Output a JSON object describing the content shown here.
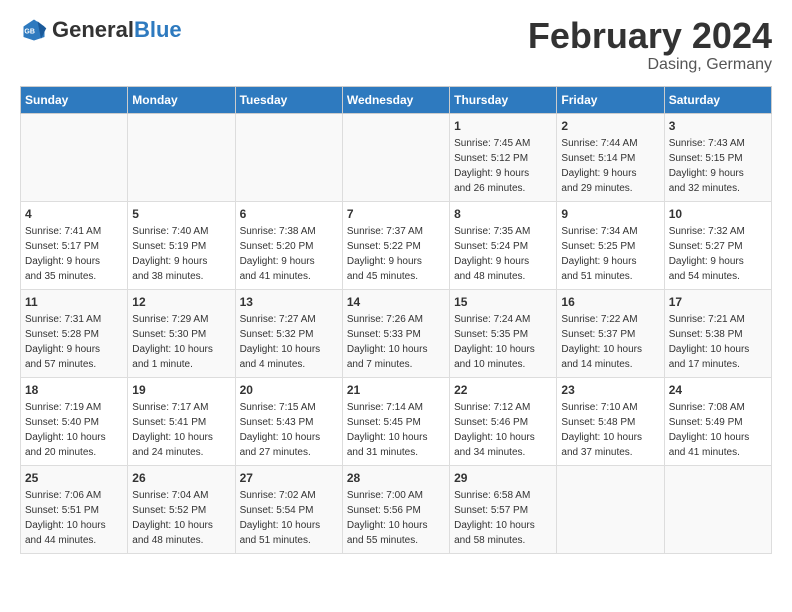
{
  "logo": {
    "text_general": "General",
    "text_blue": "Blue"
  },
  "header": {
    "month_title": "February 2024",
    "location": "Dasing, Germany"
  },
  "days_of_week": [
    "Sunday",
    "Monday",
    "Tuesday",
    "Wednesday",
    "Thursday",
    "Friday",
    "Saturday"
  ],
  "weeks": [
    [
      {
        "day": "",
        "info": ""
      },
      {
        "day": "",
        "info": ""
      },
      {
        "day": "",
        "info": ""
      },
      {
        "day": "",
        "info": ""
      },
      {
        "day": "1",
        "info": "Sunrise: 7:45 AM\nSunset: 5:12 PM\nDaylight: 9 hours\nand 26 minutes."
      },
      {
        "day": "2",
        "info": "Sunrise: 7:44 AM\nSunset: 5:14 PM\nDaylight: 9 hours\nand 29 minutes."
      },
      {
        "day": "3",
        "info": "Sunrise: 7:43 AM\nSunset: 5:15 PM\nDaylight: 9 hours\nand 32 minutes."
      }
    ],
    [
      {
        "day": "4",
        "info": "Sunrise: 7:41 AM\nSunset: 5:17 PM\nDaylight: 9 hours\nand 35 minutes."
      },
      {
        "day": "5",
        "info": "Sunrise: 7:40 AM\nSunset: 5:19 PM\nDaylight: 9 hours\nand 38 minutes."
      },
      {
        "day": "6",
        "info": "Sunrise: 7:38 AM\nSunset: 5:20 PM\nDaylight: 9 hours\nand 41 minutes."
      },
      {
        "day": "7",
        "info": "Sunrise: 7:37 AM\nSunset: 5:22 PM\nDaylight: 9 hours\nand 45 minutes."
      },
      {
        "day": "8",
        "info": "Sunrise: 7:35 AM\nSunset: 5:24 PM\nDaylight: 9 hours\nand 48 minutes."
      },
      {
        "day": "9",
        "info": "Sunrise: 7:34 AM\nSunset: 5:25 PM\nDaylight: 9 hours\nand 51 minutes."
      },
      {
        "day": "10",
        "info": "Sunrise: 7:32 AM\nSunset: 5:27 PM\nDaylight: 9 hours\nand 54 minutes."
      }
    ],
    [
      {
        "day": "11",
        "info": "Sunrise: 7:31 AM\nSunset: 5:28 PM\nDaylight: 9 hours\nand 57 minutes."
      },
      {
        "day": "12",
        "info": "Sunrise: 7:29 AM\nSunset: 5:30 PM\nDaylight: 10 hours\nand 1 minute."
      },
      {
        "day": "13",
        "info": "Sunrise: 7:27 AM\nSunset: 5:32 PM\nDaylight: 10 hours\nand 4 minutes."
      },
      {
        "day": "14",
        "info": "Sunrise: 7:26 AM\nSunset: 5:33 PM\nDaylight: 10 hours\nand 7 minutes."
      },
      {
        "day": "15",
        "info": "Sunrise: 7:24 AM\nSunset: 5:35 PM\nDaylight: 10 hours\nand 10 minutes."
      },
      {
        "day": "16",
        "info": "Sunrise: 7:22 AM\nSunset: 5:37 PM\nDaylight: 10 hours\nand 14 minutes."
      },
      {
        "day": "17",
        "info": "Sunrise: 7:21 AM\nSunset: 5:38 PM\nDaylight: 10 hours\nand 17 minutes."
      }
    ],
    [
      {
        "day": "18",
        "info": "Sunrise: 7:19 AM\nSunset: 5:40 PM\nDaylight: 10 hours\nand 20 minutes."
      },
      {
        "day": "19",
        "info": "Sunrise: 7:17 AM\nSunset: 5:41 PM\nDaylight: 10 hours\nand 24 minutes."
      },
      {
        "day": "20",
        "info": "Sunrise: 7:15 AM\nSunset: 5:43 PM\nDaylight: 10 hours\nand 27 minutes."
      },
      {
        "day": "21",
        "info": "Sunrise: 7:14 AM\nSunset: 5:45 PM\nDaylight: 10 hours\nand 31 minutes."
      },
      {
        "day": "22",
        "info": "Sunrise: 7:12 AM\nSunset: 5:46 PM\nDaylight: 10 hours\nand 34 minutes."
      },
      {
        "day": "23",
        "info": "Sunrise: 7:10 AM\nSunset: 5:48 PM\nDaylight: 10 hours\nand 37 minutes."
      },
      {
        "day": "24",
        "info": "Sunrise: 7:08 AM\nSunset: 5:49 PM\nDaylight: 10 hours\nand 41 minutes."
      }
    ],
    [
      {
        "day": "25",
        "info": "Sunrise: 7:06 AM\nSunset: 5:51 PM\nDaylight: 10 hours\nand 44 minutes."
      },
      {
        "day": "26",
        "info": "Sunrise: 7:04 AM\nSunset: 5:52 PM\nDaylight: 10 hours\nand 48 minutes."
      },
      {
        "day": "27",
        "info": "Sunrise: 7:02 AM\nSunset: 5:54 PM\nDaylight: 10 hours\nand 51 minutes."
      },
      {
        "day": "28",
        "info": "Sunrise: 7:00 AM\nSunset: 5:56 PM\nDaylight: 10 hours\nand 55 minutes."
      },
      {
        "day": "29",
        "info": "Sunrise: 6:58 AM\nSunset: 5:57 PM\nDaylight: 10 hours\nand 58 minutes."
      },
      {
        "day": "",
        "info": ""
      },
      {
        "day": "",
        "info": ""
      }
    ]
  ]
}
